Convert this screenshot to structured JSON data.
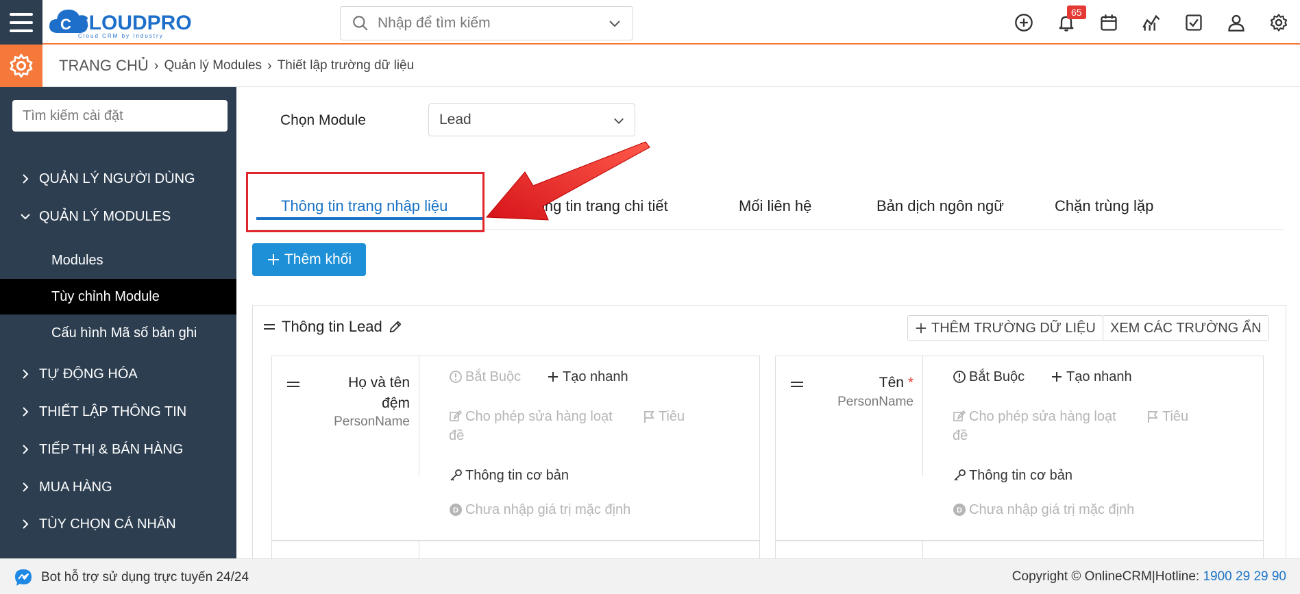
{
  "header": {
    "logo_text": "CLOUDPRO",
    "logo_tagline": "Cloud CRM by Industry",
    "search_placeholder": "Nhập để tìm kiếm",
    "notification_count": "65"
  },
  "breadcrumb": {
    "home": "TRANG CHỦ",
    "level1": "Quản lý Modules",
    "level2": "Thiết lập trường dữ liệu"
  },
  "sidebar": {
    "search_placeholder": "Tìm kiếm cài đặt",
    "items": [
      {
        "label": "QUẢN LÝ NGƯỜI DÙNG"
      },
      {
        "label": "QUẢN LÝ MODULES"
      },
      {
        "label": "TỰ ĐỘNG HÓA"
      },
      {
        "label": "THIẾT LẬP THÔNG TIN"
      },
      {
        "label": "TIẾP THỊ & BÁN HÀNG"
      },
      {
        "label": "MUA HÀNG"
      },
      {
        "label": "TÙY CHỌN CÁ NHÂN"
      }
    ],
    "subitems": [
      {
        "label": "Modules"
      },
      {
        "label": "Tùy chỉnh Module"
      },
      {
        "label": "Cấu hình Mã số bản ghi"
      }
    ]
  },
  "main": {
    "module_label": "Chọn Module",
    "module_value": "Lead",
    "tabs": [
      {
        "label": "Thông tin trang nhập liệu"
      },
      {
        "label": "Thông tin trang chi tiết"
      },
      {
        "label": "Mối liên hệ"
      },
      {
        "label": "Bản dịch ngôn ngữ"
      },
      {
        "label": "Chặn trùng lặp"
      }
    ],
    "add_block_label": "Thêm khối",
    "block": {
      "title": "Thông tin Lead",
      "add_field_label": "THÊM TRƯỜNG DỮ LIỆU",
      "hidden_fields_label": "XEM CÁC TRƯỜNG ẨN",
      "fields": [
        {
          "name_line1": "Họ và tên",
          "name_line2": "đệm",
          "type": "PersonName",
          "required": "Bắt Buộc",
          "quick_create": "Tạo nhanh",
          "mass_edit": "Cho phép sửa hàng loạt",
          "header_line1": "Tiêu",
          "header_line2": "đề",
          "basic_info": "Thông tin cơ bản",
          "default_value": "Chưa nhập giá trị mặc định"
        },
        {
          "name_line1": "Tên",
          "required_mark": "*",
          "type": "PersonName",
          "required": "Bắt Buộc",
          "quick_create": "Tạo nhanh",
          "mass_edit": "Cho phép sửa hàng loạt",
          "header_line1": "Tiêu",
          "header_line2": "đề",
          "basic_info": "Thông tin cơ bản",
          "default_value": "Chưa nhập giá trị mặc định"
        }
      ]
    }
  },
  "footer": {
    "bot_text": "Bot hỗ trợ sử dụng trực tuyến 24/24",
    "copyright": "Copyright © OnlineCRM|Hotline: ",
    "hotline": "1900 29 29 90"
  },
  "colors": {
    "accent_orange": "#f5793b",
    "sidebar_bg": "#2c3e50",
    "primary_blue": "#1e90d8",
    "highlight_red": "#e0262b"
  }
}
